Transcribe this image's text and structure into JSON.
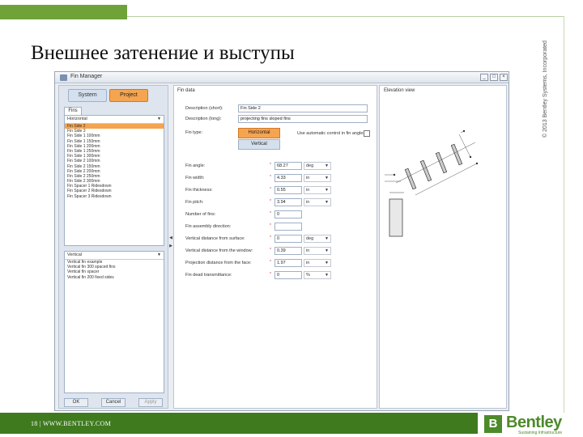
{
  "slide": {
    "title": "Внешнее затенение и выступы",
    "copyright": "© 2013 Bentley Systems, Incorporated",
    "footer": "18 | WWW.BENTLEY.COM",
    "logo_text": "Bentley",
    "logo_mark": "B",
    "logo_tagline": "Sustaining Infrastructure",
    "brand_color": "#4d8a2a"
  },
  "window": {
    "title": "Fin Manager",
    "buttons": [
      "_",
      "□",
      "×"
    ]
  },
  "left": {
    "system_label": "System",
    "project_label": "Project",
    "tab_label": "Fins",
    "combo_value": "Horizontal",
    "fins": [
      "Fin Side 2",
      "Fin Side 3",
      "Fin Side 1 100mm",
      "Fin Side 1 150mm",
      "Fin Side 1 200mm",
      "Fin Side 1 250mm",
      "Fin Side 1 300mm",
      "Fin Side 2 100mm",
      "Fin Side 2 150mm",
      "Fin Side 2 200mm",
      "Fin Side 2 250mm",
      "Fin Side 2 300mm",
      "Fin Spacer 1 Ridesdown",
      "Fin Spacer 2 Ridesdown",
      "Fin Spacer 3 Ridesdown"
    ],
    "selected_index": 0,
    "list2_header": "Vertical",
    "list2_items": [
      "Vertical fin example",
      "Vertical fin 300 spaced fins",
      "Vertical fin spacer",
      "Vertical fin 200 fixed sides"
    ],
    "ok_label": "OK",
    "cancel_label": "Cancel",
    "apply_label": "Apply"
  },
  "properties": {
    "header": "Fin data",
    "desc_short_label": "Description (short):",
    "desc_short_value": "Fin Side 2",
    "desc_long_label": "Description (long):",
    "desc_long_value": "projecting fins sloped fins",
    "fin_type_label": "Fin type:",
    "horizontal_label": "Horizontal",
    "vertical_label": "Vertical",
    "checkbox_label": "Use automatic control in fin angles",
    "rows": [
      {
        "label": "Fin angle:",
        "value": "68.27",
        "unit": "deg"
      },
      {
        "label": "Fin width:",
        "value": "4.33",
        "unit": "in"
      },
      {
        "label": "Fin thickness:",
        "value": "0.55",
        "unit": "in"
      },
      {
        "label": "Fin pitch:",
        "value": "3.94",
        "unit": "in"
      },
      {
        "label": "Number of fins:",
        "value": "0",
        "unit": ""
      },
      {
        "label": "Fin assembly direction:",
        "value": "",
        "unit": ""
      },
      {
        "label": "Vertical distance from surface:",
        "value": "0",
        "unit": "deg"
      },
      {
        "label": "Vertical distance from the window:",
        "value": "0.39",
        "unit": "in"
      },
      {
        "label": "Projection distance from the face:",
        "value": "1.97",
        "unit": "in"
      },
      {
        "label": "Fin dead transmittance:",
        "value": "0",
        "unit": "%"
      }
    ]
  },
  "elevation": {
    "header": "Elevation view"
  }
}
